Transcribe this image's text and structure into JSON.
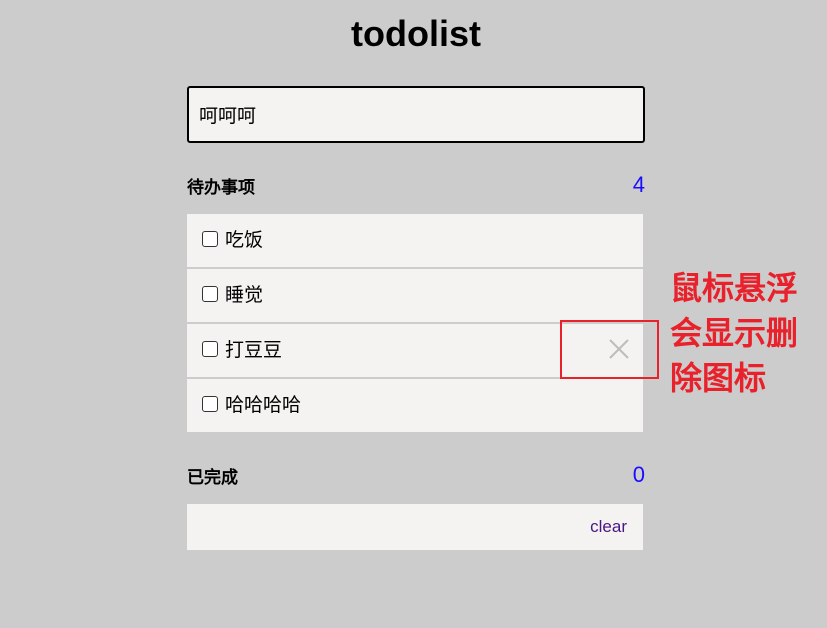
{
  "app": {
    "title": "todolist"
  },
  "new_todo": {
    "value": "呵呵呵"
  },
  "pending": {
    "label": "待办事项",
    "count": "4",
    "items": [
      {
        "text": "吃饭",
        "checked": false
      },
      {
        "text": "睡觉",
        "checked": false
      },
      {
        "text": "打豆豆",
        "checked": false,
        "hover_delete_icon": "close-icon"
      },
      {
        "text": "哈哈哈哈",
        "checked": false
      }
    ]
  },
  "completed": {
    "label": "已完成",
    "count": "0",
    "clear_label": "clear"
  },
  "annotation": {
    "text": "鼠标悬浮会显示删除图标",
    "color": "#e8212a"
  },
  "colors": {
    "background": "#cccccc",
    "item_background": "#f4f3f1",
    "count": "#1a0dff",
    "link": "#4b1682"
  }
}
